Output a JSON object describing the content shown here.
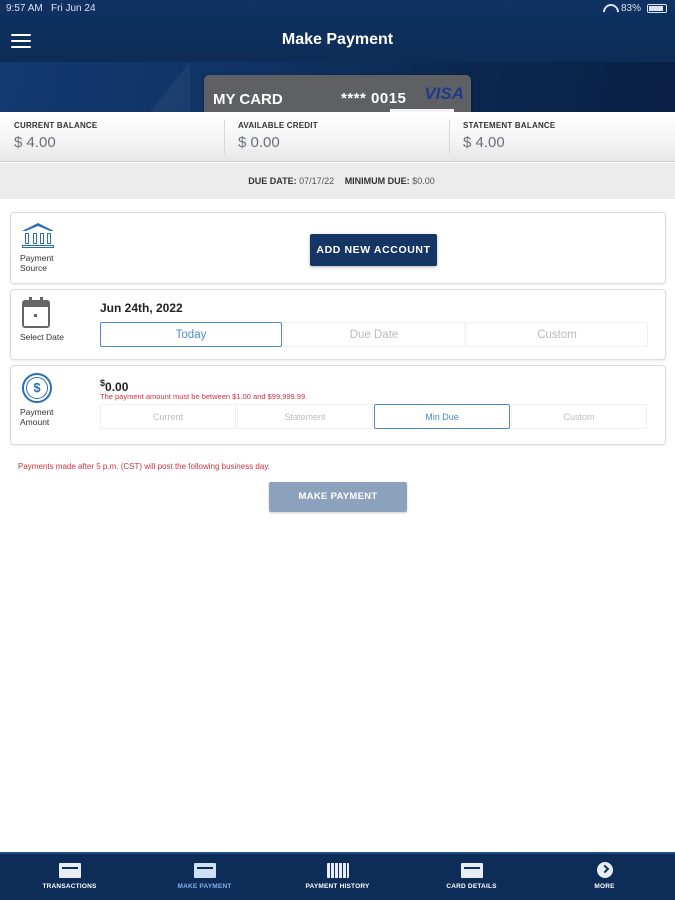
{
  "status_bar": {
    "time": "9:57 AM",
    "date": "Fri Jun 24",
    "battery": "83%"
  },
  "header": {
    "title": "Make Payment"
  },
  "card": {
    "name": "MY CARD",
    "number": "**** 0015",
    "brand": "VISA"
  },
  "balances": [
    {
      "label": "CURRENT BALANCE",
      "value": "$ 4.00"
    },
    {
      "label": "AVAILABLE CREDIT",
      "value": "$ 0.00"
    },
    {
      "label": "STATEMENT BALANCE",
      "value": "$ 4.00"
    }
  ],
  "due": {
    "due_date_label": "DUE DATE:",
    "due_date_value": "07/17/22",
    "min_due_label": "MINIMUM DUE:",
    "min_due_value": "$0.00"
  },
  "payment_source": {
    "label": "Payment Source",
    "add_button": "ADD NEW ACCOUNT"
  },
  "select_date": {
    "label": "Select Date",
    "value": "Jun 24th, 2022",
    "options": [
      "Today",
      "Due Date",
      "Custom"
    ],
    "selected": "Today"
  },
  "payment_amount": {
    "label": "Payment Amount",
    "currency": "$",
    "value": "0.00",
    "error": "The payment amount must be between $1.00 and $99,999.99.",
    "options": [
      "Current",
      "Statement",
      "Min Due",
      "Custom"
    ],
    "selected": "Min Due"
  },
  "notice": "Payments made after 5 p.m. (CST) will post the following business day.",
  "make_payment_button": "MAKE PAYMENT",
  "bottom_nav": [
    {
      "label": "TRANSACTIONS",
      "icon": "card-icon"
    },
    {
      "label": "MAKE PAYMENT",
      "icon": "card-icon",
      "active": true
    },
    {
      "label": "PAYMENT HISTORY",
      "icon": "list-icon"
    },
    {
      "label": "CARD DETAILS",
      "icon": "card-icon"
    },
    {
      "label": "MORE",
      "icon": "chevron-right-icon"
    }
  ],
  "colors": {
    "primary": "#0d2c57",
    "accent": "#4a8bd1",
    "error": "#d0313b",
    "button_dark": "#153565",
    "button_disabled": "#8ca2bc"
  }
}
